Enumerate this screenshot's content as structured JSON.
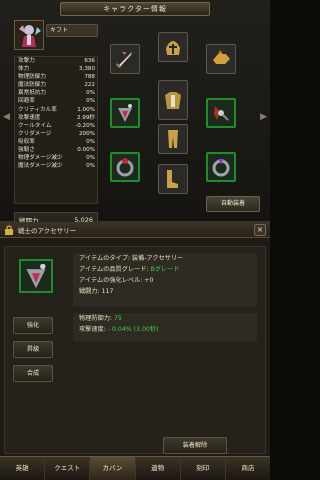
{
  "top_panel": {
    "title": "キャラクター情報",
    "character_name": "キフト",
    "stats": [
      {
        "label": "攻撃力",
        "value": "636"
      },
      {
        "label": "体力",
        "value": "3,380"
      },
      {
        "label": "物理防御力",
        "value": "788"
      },
      {
        "label": "魔法防御力",
        "value": "222"
      },
      {
        "label": "異常抵抗力",
        "value": "0%"
      },
      {
        "label": "回避率",
        "value": "0%"
      },
      {
        "label": "クリティカル率",
        "value": "1.00%"
      },
      {
        "label": "攻撃速度",
        "value": "2.99秒"
      },
      {
        "label": "クールタイム",
        "value": "-0.20%"
      },
      {
        "label": "クリダメージ",
        "value": "200%"
      },
      {
        "label": "吸収率",
        "value": "0%"
      },
      {
        "label": "強靭さ",
        "value": "0.00%"
      },
      {
        "label": "物理ダメージ減少",
        "value": "0%"
      },
      {
        "label": "魔法ダメージ減少",
        "value": "0%"
      }
    ],
    "power_label": "戦闘力",
    "power_value": "5,026",
    "auto_equip_label": "自動装着"
  },
  "detail": {
    "title": "戦士のアクセサリー",
    "close_label": "×",
    "info_lines": {
      "type": "アイテムのタイプ: 装備-アクセサリー",
      "grade_prefix": "アイテムの品質グレード: ",
      "grade_value": "Bグレード",
      "enhance": "アイテムの強化レベル: +0",
      "power": "戦闘力: 117"
    },
    "stat_lines": {
      "phys_def_prefix": "物理防御力: ",
      "phys_def_value": "75",
      "atk_speed_prefix": "攻撃速度: ",
      "atk_speed_value": "- 0.04% (3.00秒)"
    },
    "buttons": {
      "enhance": "強化",
      "upgrade": "昇級",
      "combine": "合成",
      "unequip": "装着解除"
    }
  },
  "bottom_nav": [
    "英雄",
    "クエスト",
    "カバン",
    "遺物",
    "刻印",
    "商店"
  ],
  "colors": {
    "grade_green": "#3fd14b",
    "slot_green": "#1f8d2c"
  }
}
